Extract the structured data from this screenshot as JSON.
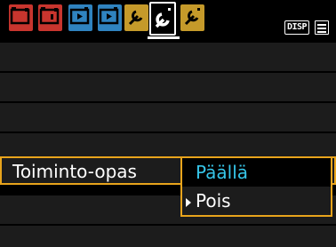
{
  "tabs": [
    {
      "id": "shoot-1",
      "icon": "camera-red-1-icon",
      "color": "#c8352e",
      "active": false
    },
    {
      "id": "shoot-2",
      "icon": "camera-red-2-icon",
      "color": "#c8352e",
      "active": false
    },
    {
      "id": "play-1",
      "icon": "play-blue-1-icon",
      "color": "#2f83bf",
      "active": false
    },
    {
      "id": "play-2",
      "icon": "play-blue-2-icon",
      "color": "#2f83bf",
      "active": false
    },
    {
      "id": "setup-1",
      "icon": "wrench-gold-1-icon",
      "color": "#c59a2a",
      "active": false
    },
    {
      "id": "setup-2",
      "icon": "wrench-gold-2-icon",
      "color": "#c59a2a",
      "active": true
    },
    {
      "id": "setup-3",
      "icon": "wrench-gold-3-icon",
      "color": "#c59a2a",
      "active": false
    }
  ],
  "header": {
    "disp_label": "DISP"
  },
  "setting": {
    "label": "Toiminto-opas"
  },
  "dropdown": {
    "options": [
      {
        "label": "Päällä",
        "highlighted": true
      },
      {
        "label": "Pois",
        "selected": true
      }
    ]
  },
  "colors": {
    "accent": "#e8a41c",
    "highlight": "#36c5e8",
    "row_bg": "#1c1c1c"
  }
}
